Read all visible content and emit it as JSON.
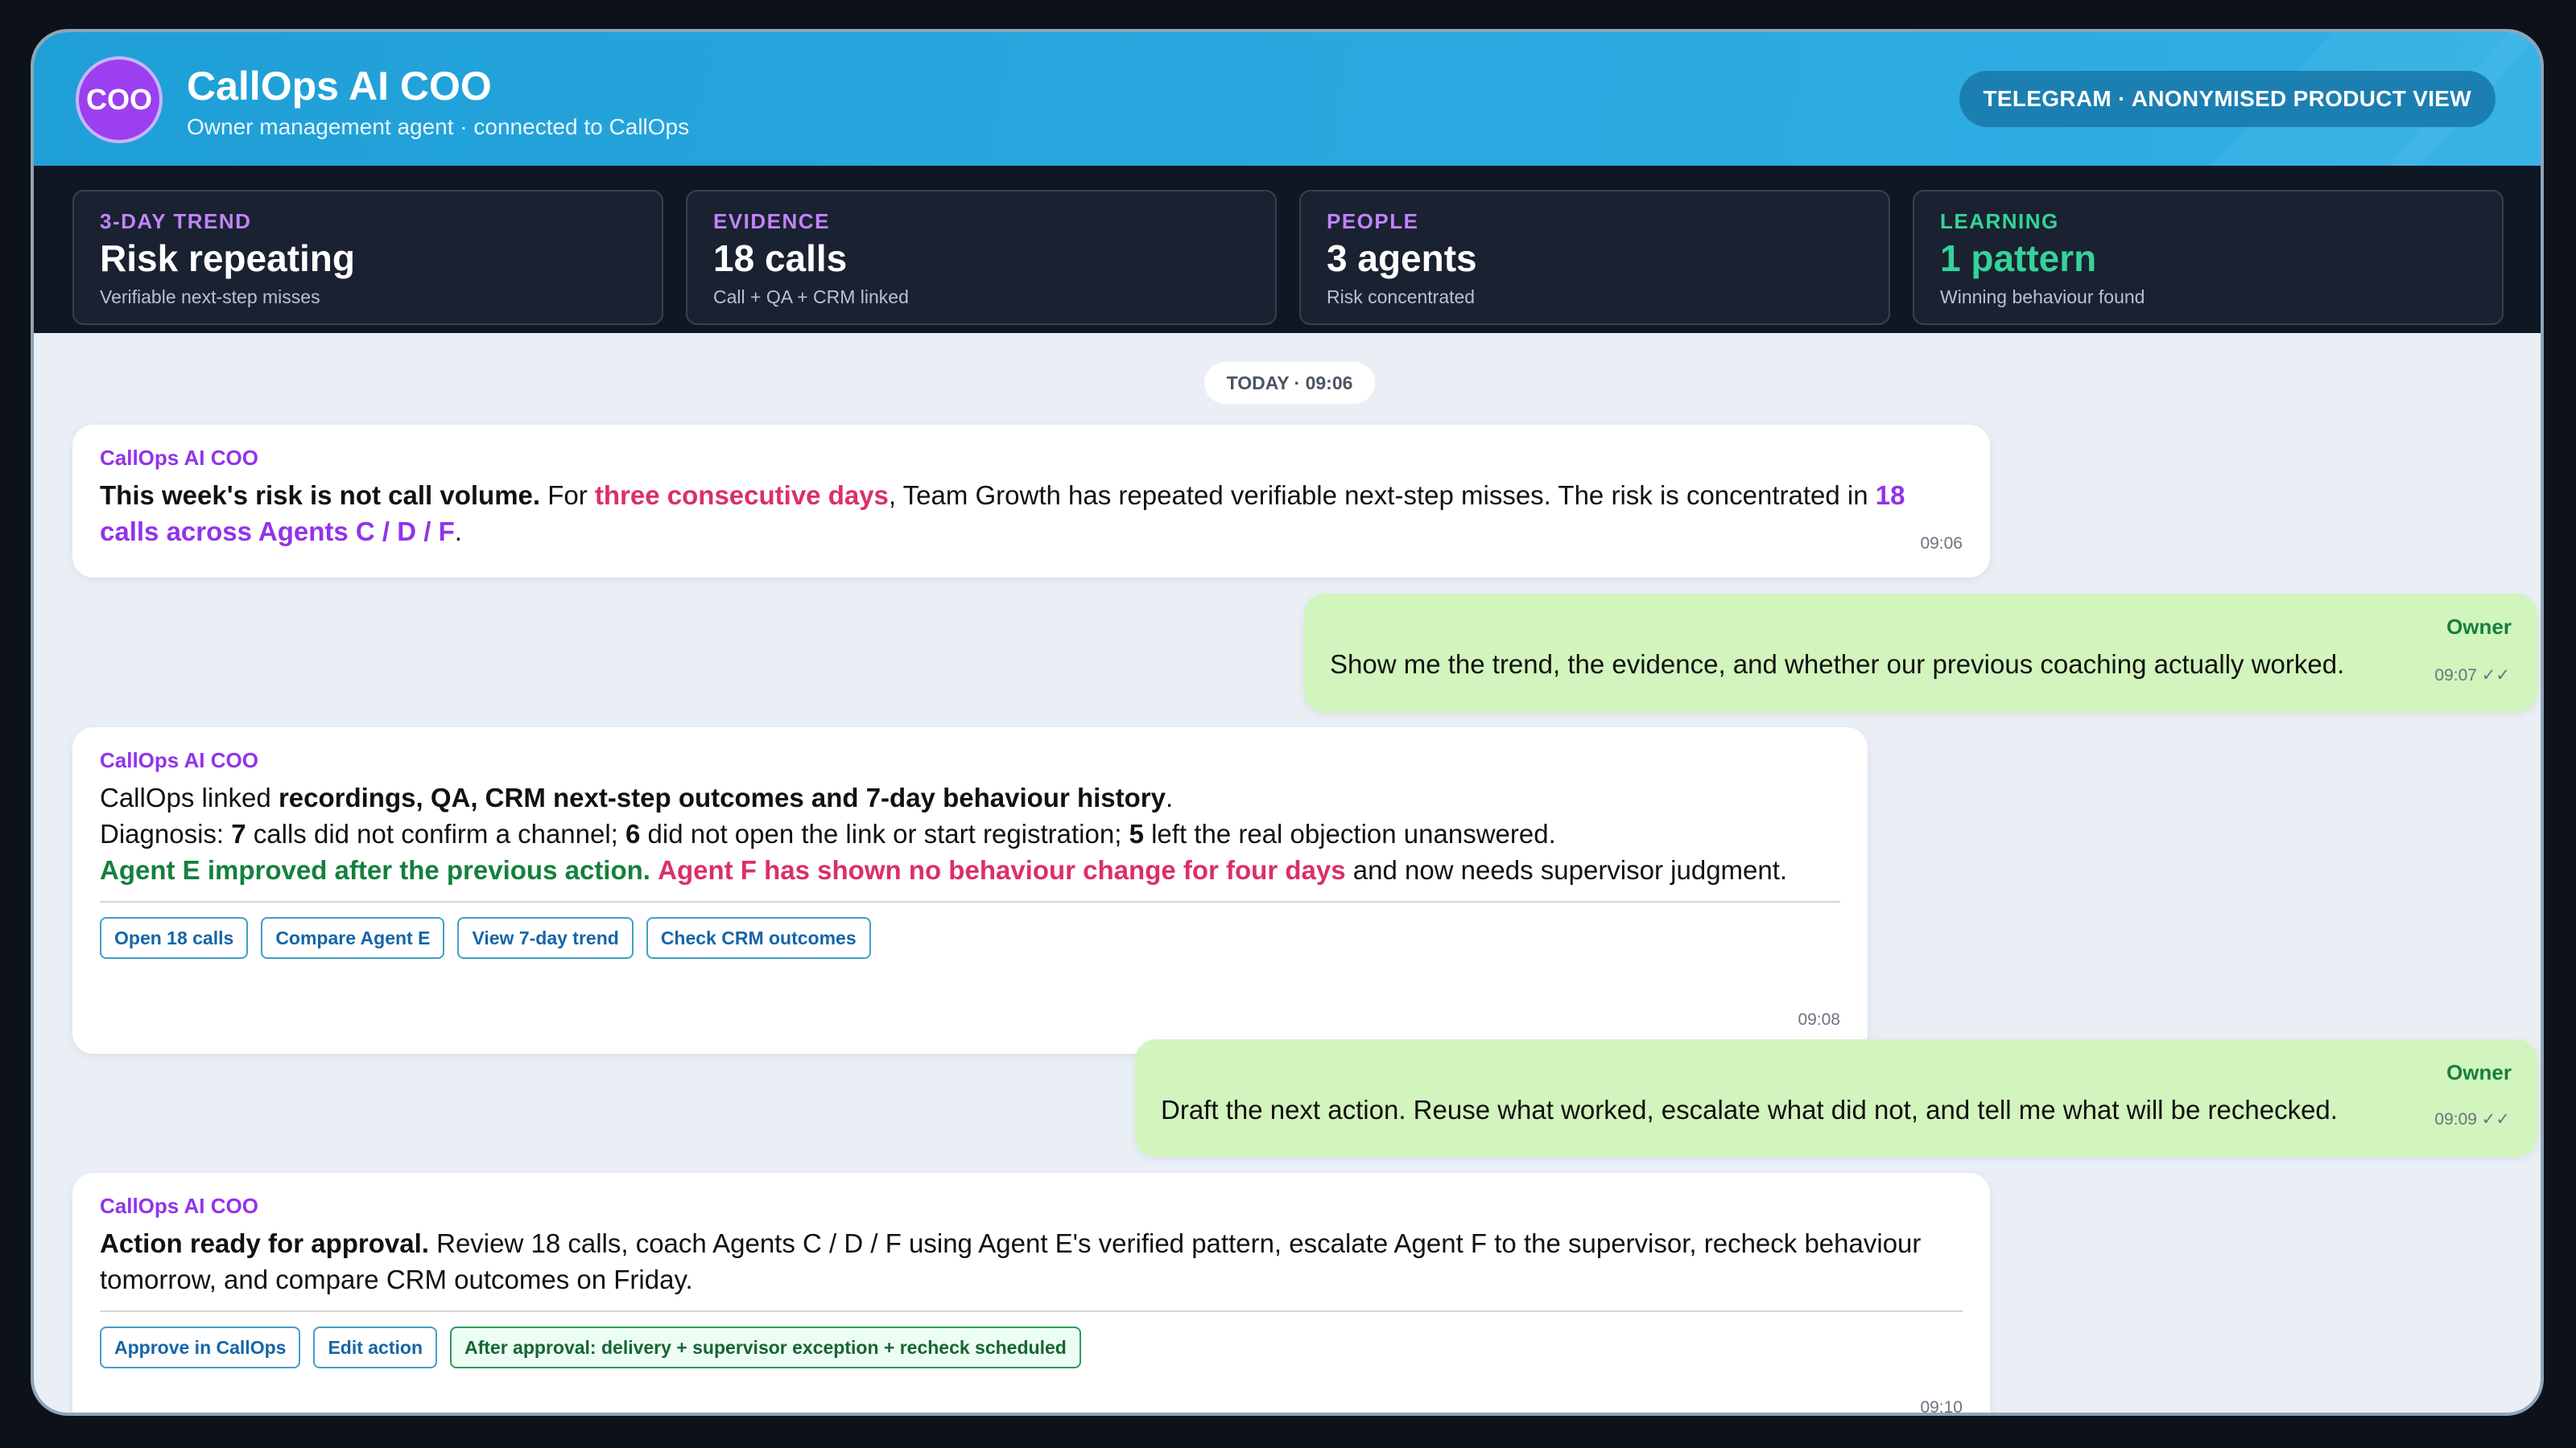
{
  "header": {
    "avatar_text": "COO",
    "title": "CallOps AI COO",
    "subtitle": "Owner management agent · connected to CallOps",
    "badge": "TELEGRAM · ANONYMISED PRODUCT VIEW",
    "color": "#2aa8df"
  },
  "stats": [
    {
      "label": "3-DAY TREND",
      "value": "Risk repeating",
      "sub": "Verifiable next-step misses",
      "color": "#c084fc"
    },
    {
      "label": "EVIDENCE",
      "value": "18 calls",
      "sub": "Call + QA + CRM linked",
      "color": "#c084fc"
    },
    {
      "label": "PEOPLE",
      "value": "3 agents",
      "sub": "Risk concentrated",
      "color": "#c084fc"
    },
    {
      "label": "LEARNING",
      "value": "1 pattern",
      "sub": "Winning behaviour found",
      "color": "#34d399"
    }
  ],
  "chat": {
    "date_label": "TODAY · 09:06",
    "messages": [
      {
        "sender": "CallOps AI COO",
        "time": "09:06",
        "parts": {
          "p1_bold": "This week's risk is not call volume.",
          "p2": " For ",
          "p3_red": "three consecutive days",
          "p4": ", Team Growth has repeated verifiable next-step misses. The risk is concentrated in ",
          "p5_purple": "18 calls across Agents C / D / F",
          "p6": "."
        }
      },
      {
        "sender": "Owner",
        "time": "09:07 ✓✓",
        "text": "Show me the trend, the evidence, and whether our previous coaching actually worked."
      },
      {
        "sender": "CallOps AI COO",
        "time": "09:08",
        "line1": {
          "a": "CallOps linked ",
          "b_bold": "recordings, QA, CRM next-step outcomes and 7-day behaviour history",
          "c": "."
        },
        "line2": {
          "a": "Diagnosis: ",
          "n1": "7",
          "b": " calls did not confirm a channel; ",
          "n2": "6",
          "c": " did not open the link or start registration; ",
          "n3": "5",
          "d": " left the real objection unanswered."
        },
        "line3": {
          "green": "Agent E improved after the previous action.",
          "sp": " ",
          "red": "Agent F has shown no behaviour change for four days",
          "rest": " and now needs supervisor judgment."
        },
        "actions": [
          "Open 18 calls",
          "Compare Agent E",
          "View 7-day trend",
          "Check CRM outcomes"
        ]
      },
      {
        "sender": "Owner",
        "time": "09:09 ✓✓",
        "text": "Draft the next action. Reuse what worked, escalate what did not, and tell me what will be rechecked."
      },
      {
        "sender": "CallOps AI COO",
        "time": "09:10",
        "bold": "Action ready for approval.",
        "text": " Review 18 calls, coach Agents C / D / F using Agent E's verified pattern, escalate Agent F to the supervisor, recheck behaviour tomorrow, and compare CRM outcomes on Friday.",
        "actions": [
          "Approve in CallOps",
          "Edit action"
        ],
        "status_chip": "After approval: delivery + supervisor exception + recheck scheduled"
      }
    ]
  }
}
